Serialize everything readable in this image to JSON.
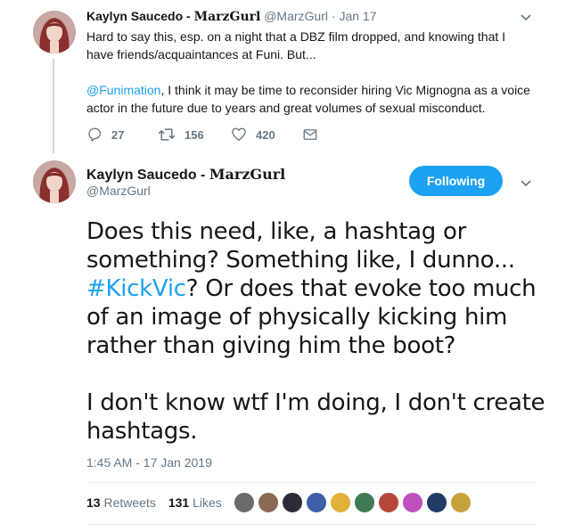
{
  "thread_tweet": {
    "display_name": "Kaylyn Saucedo - ",
    "display_name_brand": "MarzGurl",
    "handle": "@MarzGurl",
    "separator": "·",
    "date": "Jan 17",
    "text_line1": "Hard to say this, esp. on a night that a DBZ film dropped, and knowing that I",
    "text_line2": "have friends/acquaintances at Funi. But...",
    "mention": "@Funimation",
    "text_line3": ", I think it may be time to reconsider hiring Vic Mignogna as a voice",
    "text_line4": "actor in the future due to years and great volumes of sexual misconduct.",
    "replies": "27",
    "retweets": "156",
    "likes": "420"
  },
  "main_tweet": {
    "display_name": "Kaylyn Saucedo - ",
    "display_name_brand": "MarzGurl",
    "handle": "@MarzGurl",
    "follow_label": "Following",
    "line1": "Does this need, like, a hashtag or",
    "line2": "something? Something like, I dunno...",
    "hashtag": "#KickVic",
    "line3_rest": "? Or does that evoke too much",
    "line4": "of an image of physically kicking him",
    "line5": "rather than giving him the boot?",
    "line6": "I don't know wtf I'm doing, I don't create",
    "line7": "hashtags.",
    "timestamp": "1:45 AM - 17 Jan 2019",
    "retweet_count": "13",
    "retweet_label": "Retweets",
    "like_count": "131",
    "like_label": "Likes"
  },
  "icons": {
    "reply": "reply-icon",
    "retweet": "retweet-icon",
    "like": "heart-icon",
    "dm": "mail-icon",
    "caret": "chevron-down-icon"
  },
  "colors": {
    "accent": "#1da1f2",
    "muted": "#657786",
    "text": "#14171a",
    "thread_line": "#ccd6dd"
  }
}
